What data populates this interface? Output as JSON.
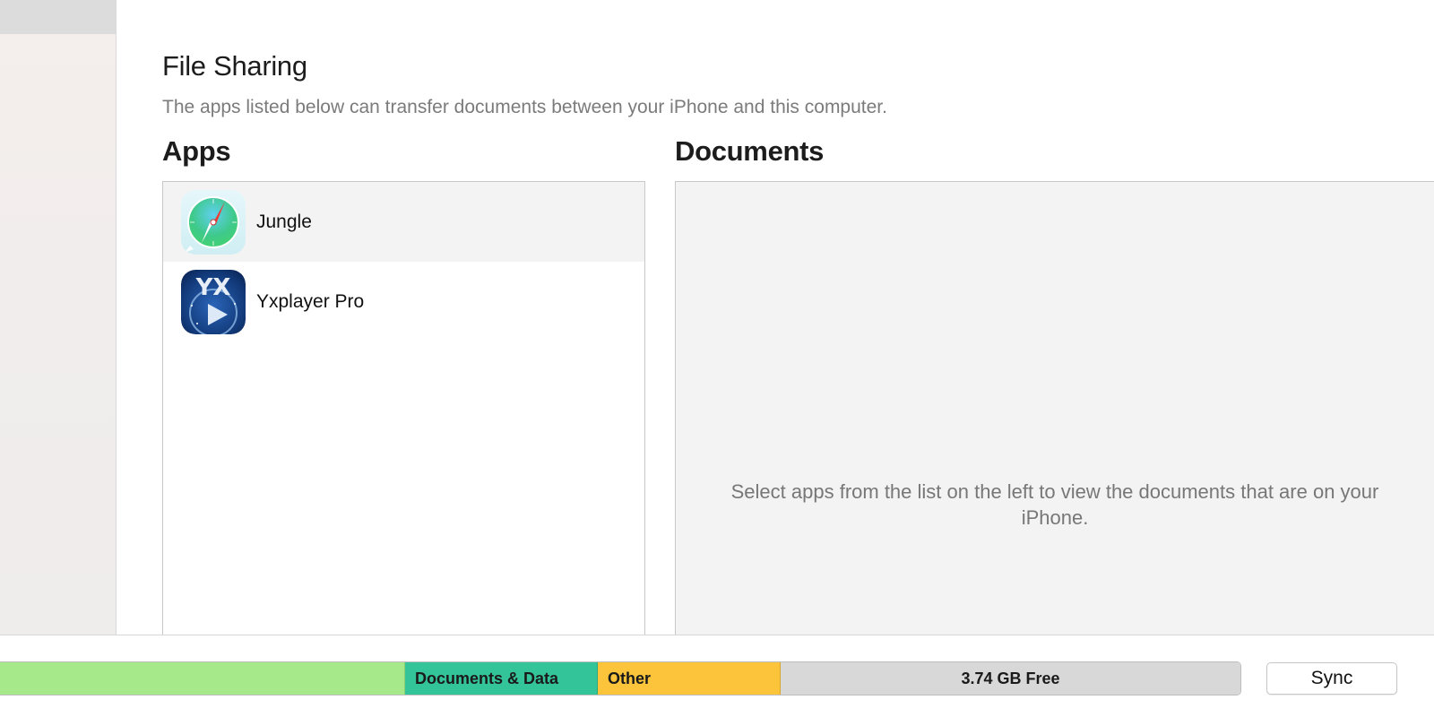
{
  "file_sharing": {
    "title": "File Sharing",
    "subtitle": "The apps listed below can transfer documents between your iPhone and this computer."
  },
  "apps": {
    "label": "Apps",
    "items": [
      {
        "name": "Jungle",
        "icon": "compass-icon",
        "selected": true
      },
      {
        "name": "Yxplayer Pro",
        "icon": "yxplayer-icon",
        "selected": false
      }
    ]
  },
  "documents": {
    "label": "Documents",
    "empty_message": "Select apps from the list on the left to view the documents that are on your iPhone."
  },
  "storage": {
    "segments": [
      {
        "label": "",
        "color": "#a6e98a"
      },
      {
        "label": "Documents & Data",
        "color": "#34c49a"
      },
      {
        "label": "Other",
        "color": "#fcc43b"
      },
      {
        "label": "3.74 GB Free",
        "color": "#d8d8d8"
      }
    ]
  },
  "actions": {
    "sync_label": "Sync"
  }
}
